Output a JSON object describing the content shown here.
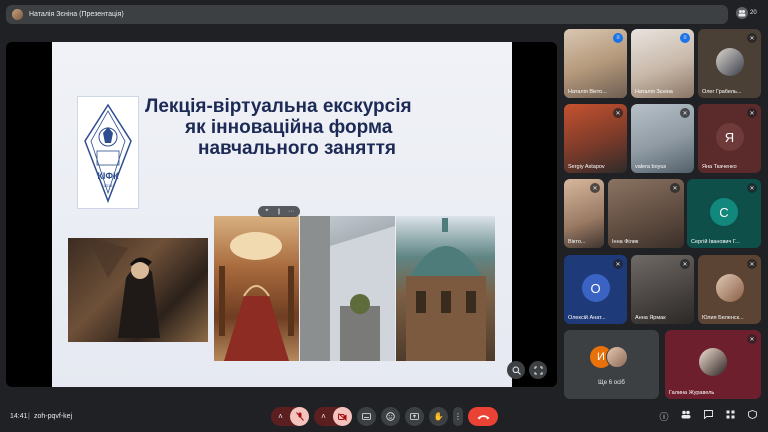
{
  "topbar": {
    "title": "Наталія Зєніна (Презентація)",
    "people_count": "20"
  },
  "slide": {
    "title_line1": "Лекція-віртуальна екскурсія",
    "title_line2": "як інноваційна форма",
    "title_line3": "навчального заняття",
    "emblem_text": "КІФК",
    "emblem_year": "2013"
  },
  "participants": [
    {
      "name": "Наталія Вікто...",
      "mic": "active"
    },
    {
      "name": "Наталія Зєніна",
      "mic": "active"
    },
    {
      "name": "Олег Грабель...",
      "mic": "muted"
    },
    {
      "name": "Sergiy Astapov",
      "mic": "muted"
    },
    {
      "name": "valera boyus",
      "mic": "muted"
    },
    {
      "name": "Яна Ткаченко",
      "mic": "muted",
      "letter": "Я"
    },
    {
      "name": "Вікто...",
      "mic": "muted"
    },
    {
      "name": "Інна Філик",
      "mic": "muted"
    },
    {
      "name": "Сергій Іванович Г...",
      "mic": "muted",
      "letter": "С"
    },
    {
      "name": "Олексій Анат...",
      "mic": "muted",
      "letter": "О"
    },
    {
      "name": "Анна Ярмак",
      "mic": "muted"
    },
    {
      "name": "Юлия Беленск...",
      "mic": "muted"
    }
  ],
  "more": {
    "label": "Ще 6 осіб",
    "letter": "И"
  },
  "last_tile": {
    "name": "Галина Журавель"
  },
  "bottom": {
    "time": "14:41",
    "separator": "|",
    "code": "zoh-pqvf-kej"
  },
  "colors": {
    "accent": "#1a73e8",
    "hangup": "#ea4335",
    "background": "#202124"
  }
}
